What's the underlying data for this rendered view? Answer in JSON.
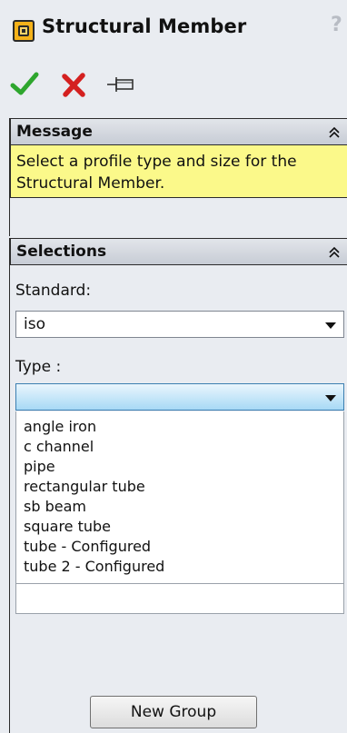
{
  "titlebar": {
    "icon": "structural-member-icon",
    "title": "Structural Member",
    "help": "?"
  },
  "toolbar": {
    "ok_icon": "checkmark-icon",
    "cancel_icon": "red-x-icon",
    "pin_icon": "pushpin-icon",
    "colors": {
      "ok": "#2ea62e",
      "cancel": "#d42020"
    }
  },
  "message": {
    "header": "Message",
    "text": "Select a profile type and size for the Structural Member.",
    "background": "#fbf98a"
  },
  "selections": {
    "header": "Selections",
    "standard_label": "Standard:",
    "standard_value": "iso",
    "type_label": "Type :",
    "type_value": "",
    "type_options": [
      "angle iron",
      "c channel",
      "pipe",
      "rectangular tube",
      "sb beam",
      "square tube",
      "tube - Configured",
      "tube 2 - Configured"
    ],
    "new_group_label": "New Group"
  }
}
